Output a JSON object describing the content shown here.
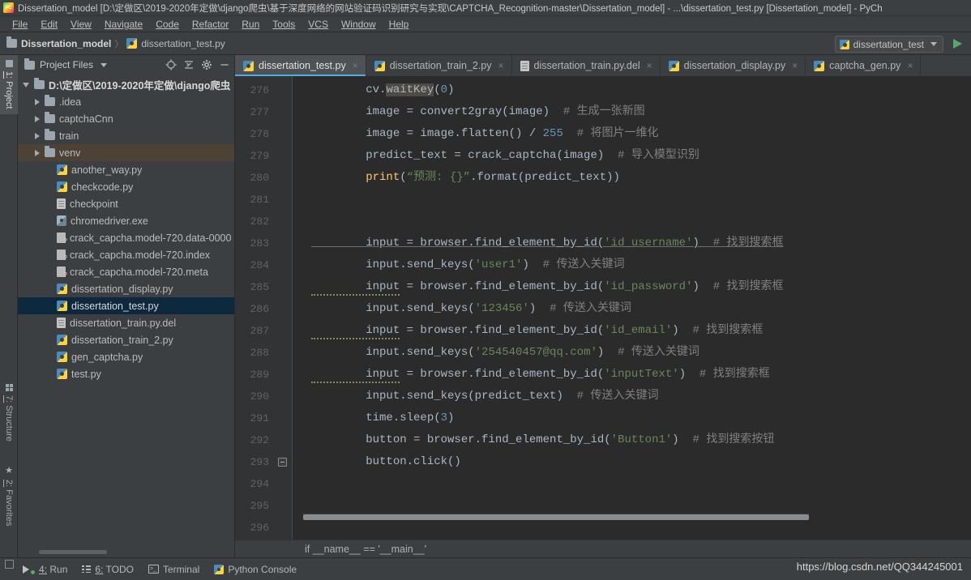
{
  "window": {
    "title": "Dissertation_model [D:\\定做区\\2019-2020年定做\\django爬虫\\基于深度网络的网站验证码识别研究与实现\\CAPTCHA_Recognition-master\\Dissertation_model] - ...\\dissertation_test.py [Dissertation_model] - PyCh",
    "logo_alt": "PC"
  },
  "menu": {
    "items": [
      {
        "label": "File"
      },
      {
        "label": "Edit"
      },
      {
        "label": "View"
      },
      {
        "label": "Navigate"
      },
      {
        "label": "Code"
      },
      {
        "label": "Refactor"
      },
      {
        "label": "Run"
      },
      {
        "label": "Tools"
      },
      {
        "label": "VCS"
      },
      {
        "label": "Window"
      },
      {
        "label": "Help"
      }
    ]
  },
  "navbar": {
    "crumbs": [
      {
        "label": "Dissertation_model",
        "icon": "folder-icon"
      },
      {
        "label": "dissertation_test.py",
        "icon": "python-file-icon"
      }
    ],
    "separator": "〉",
    "run_config": "dissertation_test",
    "run_button": "run-button"
  },
  "toolstrip": {
    "tabs": [
      {
        "num": "1:",
        "label": "Project",
        "icon": "project-folder-icon",
        "active": true
      },
      {
        "num": "7:",
        "label": "Structure",
        "icon": "structure-grid-icon",
        "active": false
      },
      {
        "num": "2:",
        "label": "Favorites",
        "icon": "star-icon",
        "active": false
      }
    ]
  },
  "project_panel": {
    "title": "Project Files",
    "header_icons": [
      {
        "name": "locate-target-icon"
      },
      {
        "name": "collapse-all-icon"
      },
      {
        "name": "gear-icon"
      },
      {
        "name": "minimize-icon"
      }
    ],
    "tree": [
      {
        "label": "D:\\定做区\\2019-2020年定做\\django爬虫",
        "icon": "folder-icon",
        "indent": 0,
        "arrow": "open",
        "root": true,
        "state": "none"
      },
      {
        "label": ".idea",
        "icon": "folder-icon",
        "indent": 1,
        "arrow": "closed",
        "state": "none"
      },
      {
        "label": "captchaCnn",
        "icon": "folder-icon",
        "indent": 1,
        "arrow": "closed",
        "state": "none"
      },
      {
        "label": "train",
        "icon": "folder-icon",
        "indent": 1,
        "arrow": "closed",
        "state": "none"
      },
      {
        "label": "venv",
        "icon": "folder-icon",
        "indent": 1,
        "arrow": "closed",
        "state": "hover"
      },
      {
        "label": "another_way.py",
        "icon": "python-file-icon",
        "indent": 2,
        "arrow": "none",
        "state": "none"
      },
      {
        "label": "checkcode.py",
        "icon": "python-file-icon",
        "indent": 2,
        "arrow": "none",
        "state": "none"
      },
      {
        "label": "checkpoint",
        "icon": "text-file-icon",
        "indent": 2,
        "arrow": "none",
        "state": "none"
      },
      {
        "label": "chromedriver.exe",
        "icon": "exe-file-icon",
        "indent": 2,
        "arrow": "none",
        "state": "none"
      },
      {
        "label": "crack_capcha.model-720.data-0000",
        "icon": "unknown-file-icon",
        "indent": 2,
        "arrow": "none",
        "state": "none"
      },
      {
        "label": "crack_capcha.model-720.index",
        "icon": "unknown-file-icon",
        "indent": 2,
        "arrow": "none",
        "state": "none"
      },
      {
        "label": "crack_capcha.model-720.meta",
        "icon": "unknown-file-icon",
        "indent": 2,
        "arrow": "none",
        "state": "none"
      },
      {
        "label": "dissertation_display.py",
        "icon": "python-file-icon",
        "indent": 2,
        "arrow": "none",
        "state": "none"
      },
      {
        "label": "dissertation_test.py",
        "icon": "python-file-icon",
        "indent": 2,
        "arrow": "none",
        "state": "selected"
      },
      {
        "label": "dissertation_train.py.del",
        "icon": "text-file-icon",
        "indent": 2,
        "arrow": "none",
        "state": "none"
      },
      {
        "label": "dissertation_train_2.py",
        "icon": "python-file-icon",
        "indent": 2,
        "arrow": "none",
        "state": "none"
      },
      {
        "label": "gen_captcha.py",
        "icon": "python-file-icon",
        "indent": 2,
        "arrow": "none",
        "state": "none"
      },
      {
        "label": "test.py",
        "icon": "python-file-icon",
        "indent": 2,
        "arrow": "none",
        "state": "none"
      }
    ]
  },
  "editor": {
    "tabs": [
      {
        "label": "dissertation_test.py",
        "icon": "python-file-icon",
        "active": true,
        "close": "×"
      },
      {
        "label": "dissertation_train_2.py",
        "icon": "python-file-icon",
        "active": false,
        "close": "×"
      },
      {
        "label": "dissertation_train.py.del",
        "icon": "text-file-icon",
        "active": false,
        "close": "×"
      },
      {
        "label": "dissertation_display.py",
        "icon": "python-file-icon",
        "active": false,
        "close": "×"
      },
      {
        "label": "captcha_gen.py",
        "icon": "python-file-icon",
        "active": false,
        "close": "×"
      }
    ],
    "line_numbers": [
      "276",
      "277",
      "278",
      "279",
      "280",
      "281",
      "282",
      "283",
      "284",
      "285",
      "286",
      "287",
      "288",
      "289",
      "290",
      "291",
      "292",
      "293",
      "294",
      "295",
      "296"
    ],
    "lines": [
      {
        "n": "276",
        "tokens": [
          {
            "t": "        ",
            "c": "id"
          },
          {
            "t": "cv.",
            "c": "id"
          },
          {
            "t": "waitKey",
            "c": "hl"
          },
          {
            "t": "(",
            "c": "id"
          },
          {
            "t": "0",
            "c": "num"
          },
          {
            "t": ")",
            "c": "id"
          }
        ]
      },
      {
        "n": "277",
        "tokens": [
          {
            "t": "        image = convert2gray(image)  ",
            "c": "id"
          },
          {
            "t": "# 生成一张新图",
            "c": "cmt"
          }
        ]
      },
      {
        "n": "278",
        "tokens": [
          {
            "t": "        image = image.flatten() / ",
            "c": "id"
          },
          {
            "t": "255",
            "c": "num"
          },
          {
            "t": "  ",
            "c": "id"
          },
          {
            "t": "# 将图片一维化",
            "c": "cmt"
          }
        ]
      },
      {
        "n": "279",
        "tokens": [
          {
            "t": "        predict_text = crack_captcha(image)  ",
            "c": "id"
          },
          {
            "t": "# 导入模型识别",
            "c": "cmt"
          }
        ]
      },
      {
        "n": "280",
        "tokens": [
          {
            "t": "        ",
            "c": "id"
          },
          {
            "t": "print",
            "c": "fn"
          },
          {
            "t": "(",
            "c": "id"
          },
          {
            "t": "“预测: {}”",
            "c": "str"
          },
          {
            "t": ".format(predict_text))",
            "c": "id"
          }
        ]
      },
      {
        "n": "281",
        "tokens": []
      },
      {
        "n": "282",
        "tokens": []
      },
      {
        "n": "283",
        "tokens": [
          {
            "t": "        input = browser.find_element_by_id(",
            "c": "warn"
          },
          {
            "t": "'id_username'",
            "c": "strwarn"
          },
          {
            "t": ")  ",
            "c": "warn"
          },
          {
            "t": "# 找到搜索框",
            "c": "cmtwarn"
          }
        ]
      },
      {
        "n": "284",
        "tokens": [
          {
            "t": "        input.send_keys(",
            "c": "id"
          },
          {
            "t": "'user1'",
            "c": "str"
          },
          {
            "t": ")  ",
            "c": "id"
          },
          {
            "t": "# 传送入关键词",
            "c": "cmt"
          }
        ]
      },
      {
        "n": "285",
        "tokens": [
          {
            "t": "        input",
            "c": "sq"
          },
          {
            "t": " = browser.find_element_by_id(",
            "c": "id"
          },
          {
            "t": "'id_password'",
            "c": "str"
          },
          {
            "t": ")  ",
            "c": "id"
          },
          {
            "t": "# 找到搜索框",
            "c": "cmt"
          }
        ]
      },
      {
        "n": "286",
        "tokens": [
          {
            "t": "        input.send_keys(",
            "c": "id"
          },
          {
            "t": "'123456'",
            "c": "str"
          },
          {
            "t": ")  ",
            "c": "id"
          },
          {
            "t": "# 传送入关键词",
            "c": "cmt"
          }
        ]
      },
      {
        "n": "287",
        "tokens": [
          {
            "t": "        input",
            "c": "sq"
          },
          {
            "t": " = browser.find_element_by_id(",
            "c": "id"
          },
          {
            "t": "'id_email'",
            "c": "str"
          },
          {
            "t": ")  ",
            "c": "id"
          },
          {
            "t": "# 找到搜索框",
            "c": "cmt"
          }
        ]
      },
      {
        "n": "288",
        "tokens": [
          {
            "t": "        input.send_keys(",
            "c": "id"
          },
          {
            "t": "'254540457@qq.com'",
            "c": "str"
          },
          {
            "t": ")  ",
            "c": "id"
          },
          {
            "t": "# 传送入关键词",
            "c": "cmt"
          }
        ]
      },
      {
        "n": "289",
        "tokens": [
          {
            "t": "        input",
            "c": "sq"
          },
          {
            "t": " = browser.find_element_by_id(",
            "c": "id"
          },
          {
            "t": "'inputText'",
            "c": "str"
          },
          {
            "t": ")  ",
            "c": "id"
          },
          {
            "t": "# 找到搜索框",
            "c": "cmt"
          }
        ]
      },
      {
        "n": "290",
        "tokens": [
          {
            "t": "        input.send_keys(predict_text)  ",
            "c": "id"
          },
          {
            "t": "# 传送入关键词",
            "c": "cmt"
          }
        ]
      },
      {
        "n": "291",
        "tokens": [
          {
            "t": "        time.sleep(",
            "c": "id"
          },
          {
            "t": "3",
            "c": "num"
          },
          {
            "t": ")",
            "c": "id"
          }
        ]
      },
      {
        "n": "292",
        "tokens": [
          {
            "t": "        button = browser.find_element_by_id(",
            "c": "id"
          },
          {
            "t": "'Button1'",
            "c": "str"
          },
          {
            "t": ")  ",
            "c": "id"
          },
          {
            "t": "# 找到搜索按钮",
            "c": "cmt"
          }
        ]
      },
      {
        "n": "293",
        "tokens": [
          {
            "t": "        button.click()",
            "c": "id"
          }
        ]
      },
      {
        "n": "294",
        "tokens": []
      },
      {
        "n": "295",
        "tokens": []
      },
      {
        "n": "296",
        "tokens": []
      }
    ],
    "breadcrumb": "if __name__ == '__main__'",
    "fold_marker_line": "293"
  },
  "statusbar": {
    "items": [
      {
        "num": "4:",
        "label": "Run",
        "icon": "run-icon"
      },
      {
        "num": "6:",
        "label": "TODO",
        "icon": "todo-list-icon"
      },
      {
        "num": "",
        "label": "Terminal",
        "icon": "terminal-icon"
      },
      {
        "num": "",
        "label": "Python Console",
        "icon": "python-console-icon"
      }
    ],
    "watermark": "https://blog.csdn.net/QQ344245001"
  },
  "colors": {
    "bg_chrome": "#3c3f41",
    "bg_editor": "#2b2b2b",
    "gutter": "#313335",
    "accent_tab": "#4eade5",
    "selection": "#0d293e",
    "hover_row": "#4c4336",
    "string": "#6a8759",
    "number": "#6897bb",
    "comment": "#808080",
    "function": "#ffc66d",
    "identifier": "#a9b7c6",
    "run_green": "#59a869"
  }
}
